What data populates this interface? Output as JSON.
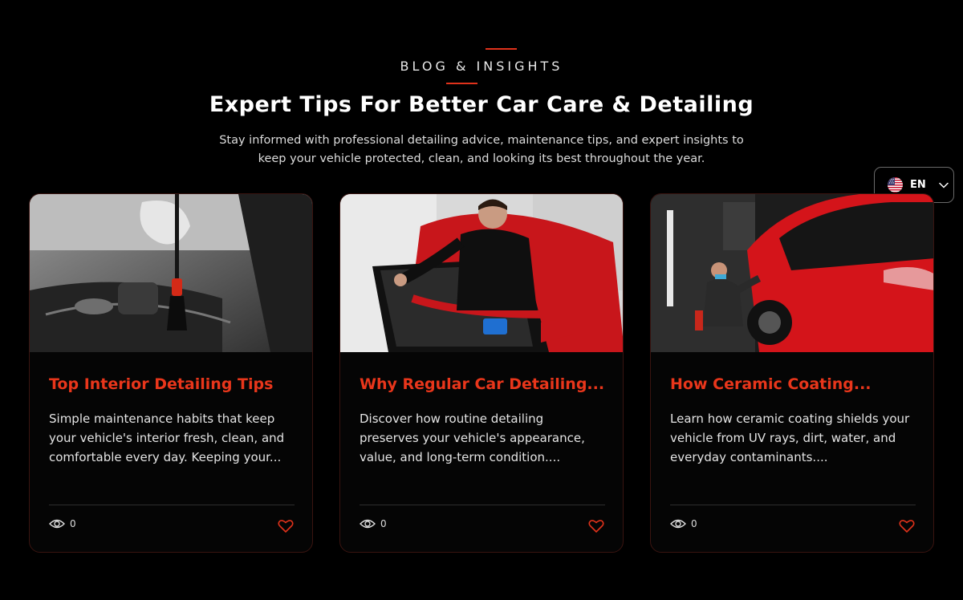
{
  "header": {
    "eyebrow": "BLOG & INSIGHTS",
    "title": "Expert Tips For Better Car Care & Detailing",
    "subtitle_line1": "Stay informed with professional detailing advice, maintenance tips, and expert insights to",
    "subtitle_line2": "keep your vehicle protected, clean, and looking its best throughout the year."
  },
  "language": {
    "label": "EN",
    "flag": "us-flag-icon"
  },
  "accent_color": "#e0321b",
  "cards": [
    {
      "title": "Top Interior Detailing Tips",
      "description": "Simple maintenance habits that keep your vehicle's interior fresh, clean, and comfortable every day. Keeping your...",
      "views": "0",
      "image": "interior-brush-photo"
    },
    {
      "title": "Why Regular Car Detailing...",
      "description": "Discover how routine detailing preserves your vehicle's appearance, value, and long-term condition....",
      "views": "0",
      "image": "door-cleaning-photo"
    },
    {
      "title": "How Ceramic Coating...",
      "description": "Learn how ceramic coating shields your vehicle from UV rays, dirt, water, and everyday contaminants....",
      "views": "0",
      "image": "ceramic-coating-photo"
    }
  ]
}
